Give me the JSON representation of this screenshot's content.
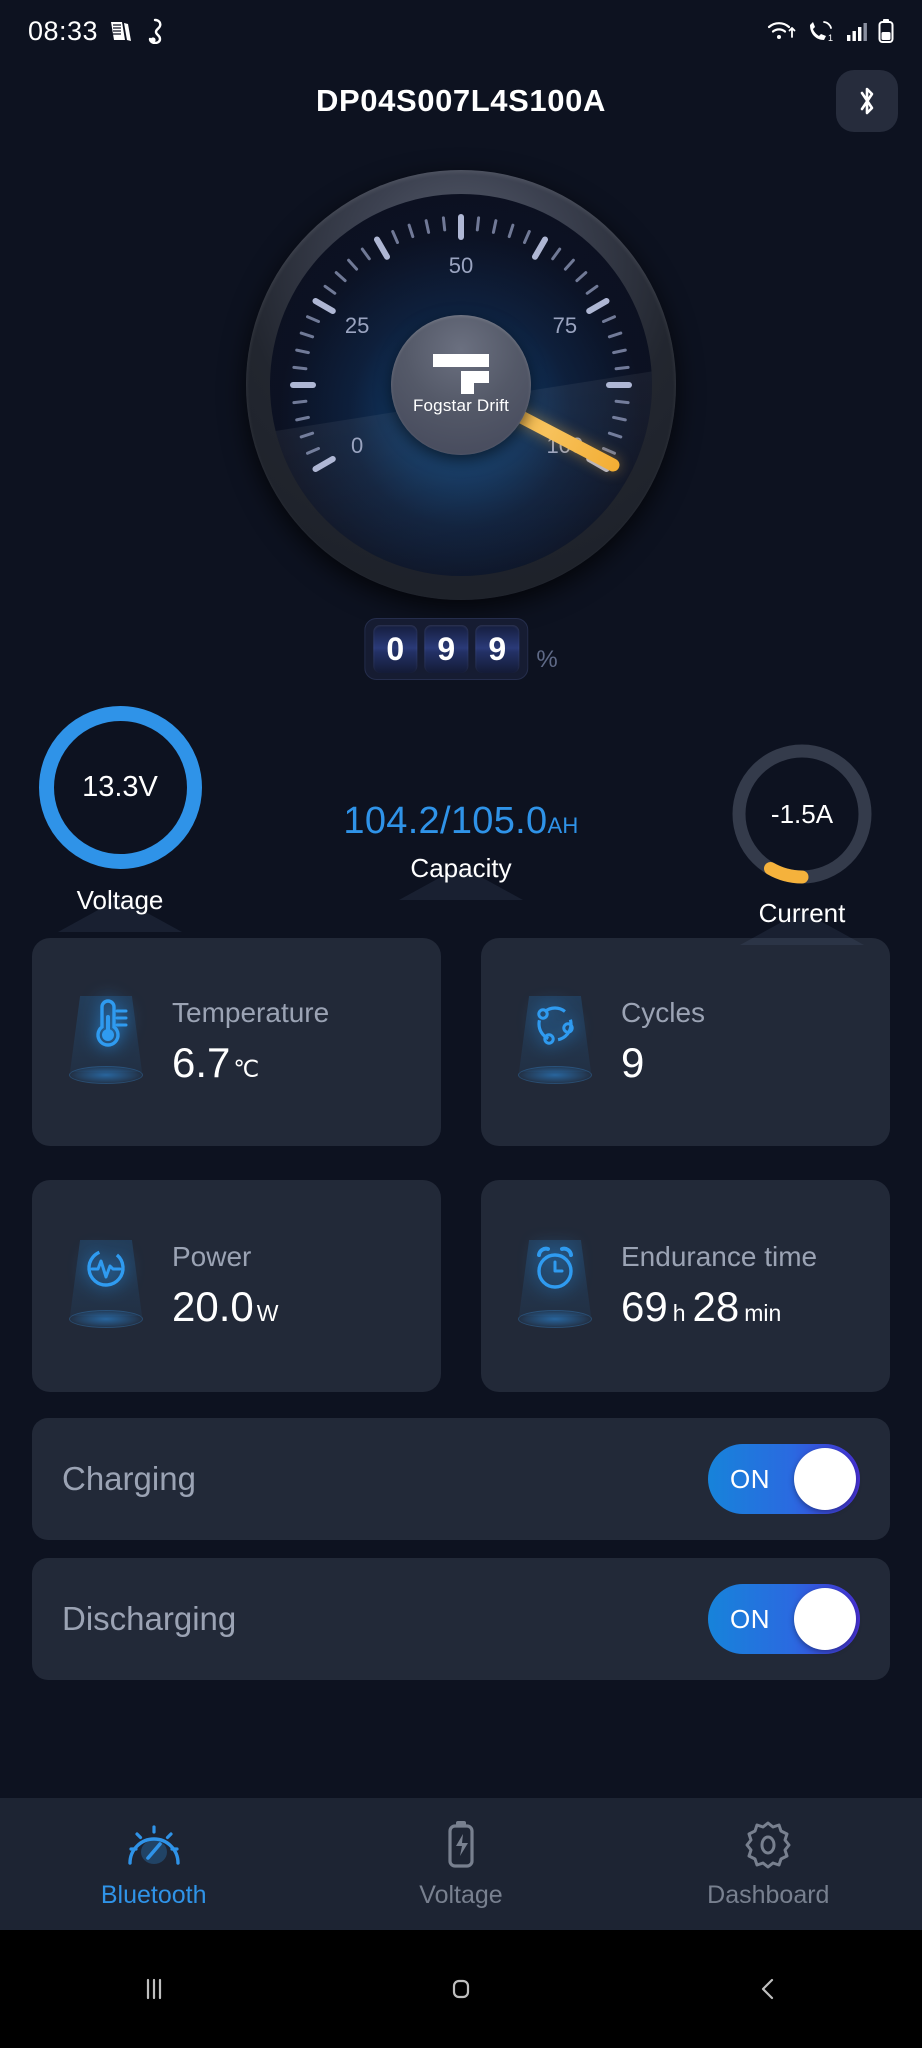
{
  "statusbar": {
    "time": "08:33",
    "icons_left": [
      "news-icon",
      "app-icon"
    ],
    "icons_right": [
      "wifi-icon",
      "call-icon",
      "signal-icon",
      "battery-icon"
    ]
  },
  "header": {
    "title": "DP04S007L4S100A",
    "bluetooth_button": "bluetooth-icon"
  },
  "gauge": {
    "min": 0,
    "max": 100,
    "value": 99,
    "tick_labels": [
      "0",
      "25",
      "50",
      "75",
      "100"
    ],
    "hub_brand": "Fogstar Drift",
    "needle_color": "#f5b23c"
  },
  "soc": {
    "digits": [
      "0",
      "9",
      "9"
    ],
    "unit": "%"
  },
  "readings": {
    "voltage": {
      "value": "13.3V",
      "label": "Voltage",
      "ring_color": "#2f93e8",
      "ring_fraction": 1.0
    },
    "capacity": {
      "value": "104.2/105.0",
      "unit": "AH",
      "label": "Capacity",
      "color": "#2f93e8"
    },
    "current": {
      "value": "-1.5A",
      "label": "Current",
      "ring_color": "#f5b23c",
      "ring_fraction": 0.06
    }
  },
  "cards": [
    {
      "icon": "thermometer-icon",
      "label": "Temperature",
      "value": "6.7",
      "unit": "℃"
    },
    {
      "icon": "cycles-icon",
      "label": "Cycles",
      "value": "9",
      "unit": ""
    },
    {
      "icon": "power-pulse-icon",
      "label": "Power",
      "value": "20.0",
      "unit": "W"
    },
    {
      "icon": "alarm-clock-icon",
      "label": "Endurance time",
      "value": "69",
      "unit": "h",
      "value2": "28",
      "unit2": "min"
    }
  ],
  "toggles": [
    {
      "label": "Charging",
      "state": "ON"
    },
    {
      "label": "Discharging",
      "state": "ON"
    }
  ],
  "bottom_nav": [
    {
      "icon": "gauge-icon",
      "label": "Bluetooth",
      "active": true
    },
    {
      "icon": "battery-bolt-icon",
      "label": "Voltage",
      "active": false
    },
    {
      "icon": "gear-icon",
      "label": "Dashboard",
      "active": false
    }
  ],
  "android_nav": [
    "recents-icon",
    "home-icon",
    "back-icon"
  ]
}
